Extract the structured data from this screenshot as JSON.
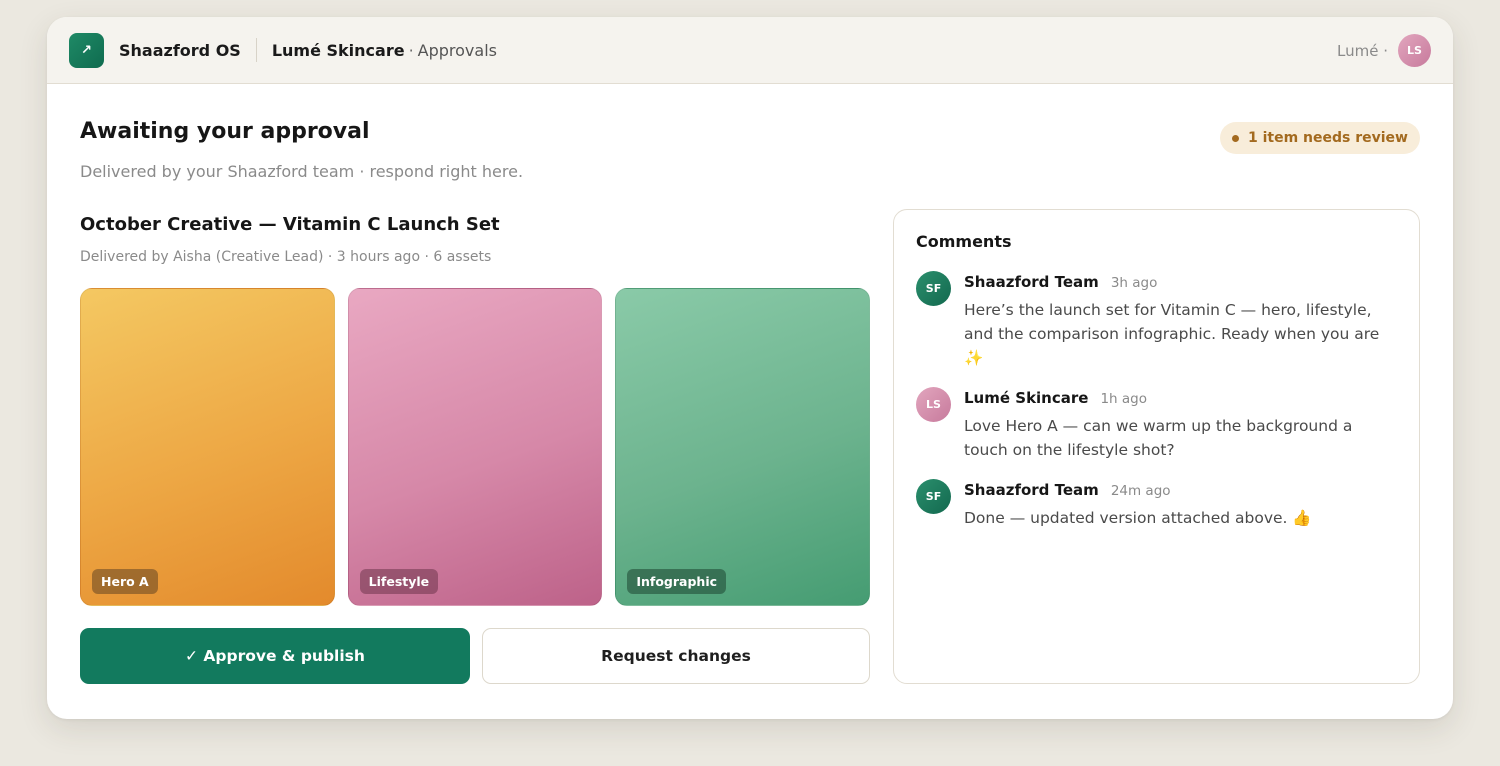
{
  "topbar": {
    "logo_glyph": "↗",
    "brand": "Shaazford OS",
    "client": "Lumé Skincare",
    "separator": "·",
    "section": "Approvals",
    "user_label": "Lumé ·",
    "user_initials": "LS"
  },
  "header": {
    "title": "Awaiting your approval",
    "subtitle": "Delivered by your Shaazford team · respond right here.",
    "badge": "1 item needs review"
  },
  "set": {
    "title": "October Creative — Vitamin C Launch Set",
    "meta": "Delivered by Aisha (Creative Lead) · 3 hours ago · 6 assets",
    "assets": [
      {
        "label": "Hero A"
      },
      {
        "label": "Lifestyle"
      },
      {
        "label": "Infographic"
      }
    ]
  },
  "actions": {
    "approve_label": "✓ Approve & publish",
    "request_label": "Request changes"
  },
  "comments": {
    "title": "Comments",
    "items": [
      {
        "initials": "SF",
        "author": "Shaazford Team",
        "time": "3h ago",
        "text": "Here’s the launch set for Vitamin C — hero, lifestyle, and the comparison infographic. Ready when you are ✨"
      },
      {
        "initials": "LS",
        "author": "Lumé Skincare",
        "time": "1h ago",
        "text": "Love Hero A — can we warm up the background a touch on the lifestyle shot?"
      },
      {
        "initials": "SF",
        "author": "Shaazford Team",
        "time": "24m ago",
        "text": "Done — updated version attached above. 👍"
      }
    ]
  },
  "colors": {
    "accent": "#127a5e",
    "badge_bg": "#f8edda",
    "badge_text": "#a36a1f"
  }
}
